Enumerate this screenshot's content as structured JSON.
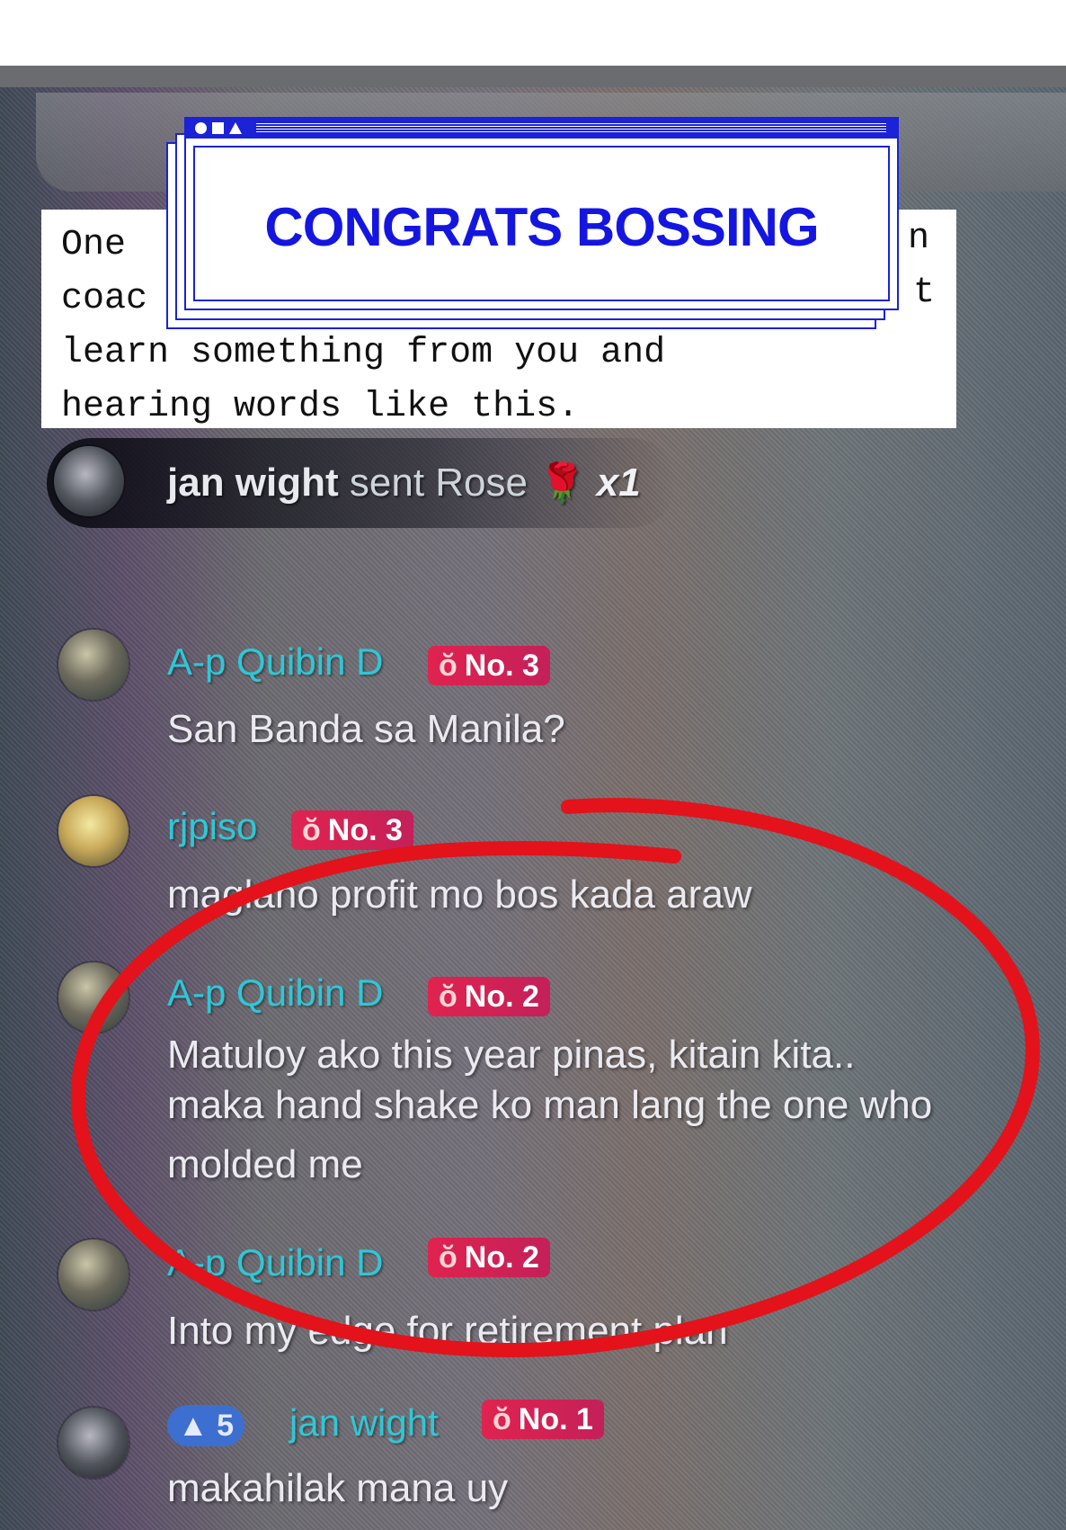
{
  "overlay": {
    "banner_title": "CONGRATS BOSSING",
    "quote_lines": [
      "One",
      "coac",
      "learn something from you and",
      "hearing words like this."
    ],
    "quote_tail_1": "n",
    "quote_tail_2": "t"
  },
  "gift_event": {
    "user": "jan wight",
    "action": "sent Rose",
    "gift_icon": "rose-icon",
    "count": "x1"
  },
  "comments": [
    {
      "user": "A-p Quibin D",
      "rank": "No. 3",
      "message": "San Banda sa Manila?"
    },
    {
      "user": "rjpiso",
      "rank": "No. 3",
      "message": "maglano profit mo bos kada araw"
    },
    {
      "user": "A-p Quibin D",
      "rank": "No. 2",
      "message_lines": [
        "Matuloy ako this year pinas, kitain kita..",
        "maka hand shake ko man lang the one who",
        "molded me"
      ]
    },
    {
      "user": "A-p Quibin D",
      "rank": "No. 2",
      "message": "Into my edge for retirement plan"
    },
    {
      "user": "jan wight",
      "level": "5",
      "rank": "No. 1",
      "message": "makahilak mana uy"
    }
  ],
  "colors": {
    "banner_blue": "#1416e0",
    "annotation_red": "#e3121b",
    "username_cyan": "#2fc7d6",
    "rank_badge": "#e0234f"
  }
}
